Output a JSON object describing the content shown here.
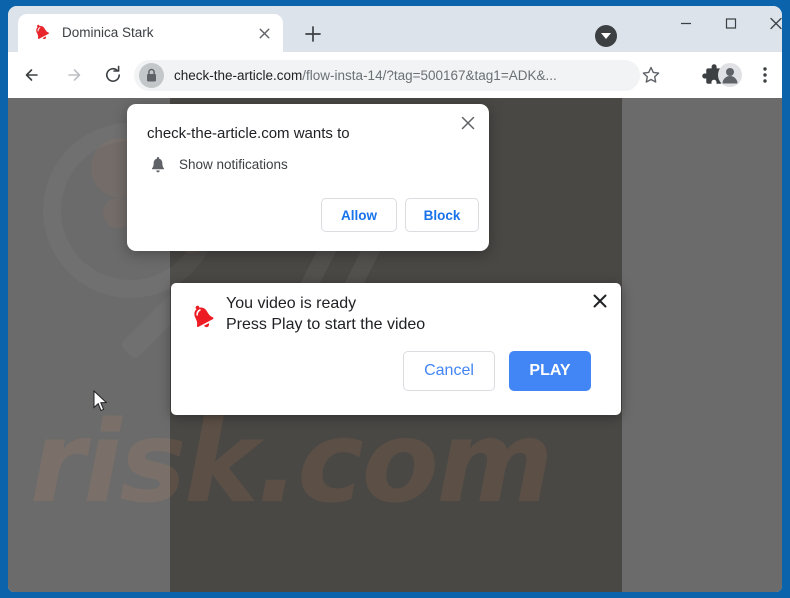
{
  "window": {
    "frame_color": "#0b63ab",
    "controls": {
      "minimize_label": "Minimize",
      "maximize_label": "Maximize",
      "close_label": "Close"
    }
  },
  "tabs": {
    "active": {
      "title": "Dominica Stark",
      "favicon": "red-bell-icon",
      "close_label": "Close tab"
    },
    "new_tab_label": "New tab",
    "tab_search_label": "Search tabs"
  },
  "toolbar": {
    "back_label": "Back",
    "forward_label": "Forward",
    "reload_label": "Reload",
    "bookmark_label": "Bookmark this tab",
    "extensions_label": "Extensions",
    "profile_label": "Profile",
    "menu_label": "Customize and control Google Chrome",
    "omnibox": {
      "lock_icon": "lock-icon",
      "url_domain": "check-the-article.com",
      "url_path": "/flow-insta-14/?tag=500167&tag1=ADK&...",
      "url_full": "check-the-article.com/flow-insta-14/?tag=500167&tag1=ADK&..."
    }
  },
  "page": {
    "background_color": "#6b6b6b",
    "panel_color": "#4a4845",
    "watermark_text": "risk.com",
    "watermark_slashes": "//"
  },
  "permission_dialog": {
    "title": "check-the-article.com wants to",
    "option_icon": "bell-icon",
    "option_label": "Show notifications",
    "allow_label": "Allow",
    "block_label": "Block",
    "close_label": "Close",
    "accent_color": "#1a73e8"
  },
  "video_dialog": {
    "icon": "red-bell-icon",
    "line1": "You video is ready",
    "line2": "Press Play to start the video",
    "cancel_label": "Cancel",
    "play_label": "PLAY",
    "close_label": "Close",
    "play_color": "#4285f4"
  }
}
